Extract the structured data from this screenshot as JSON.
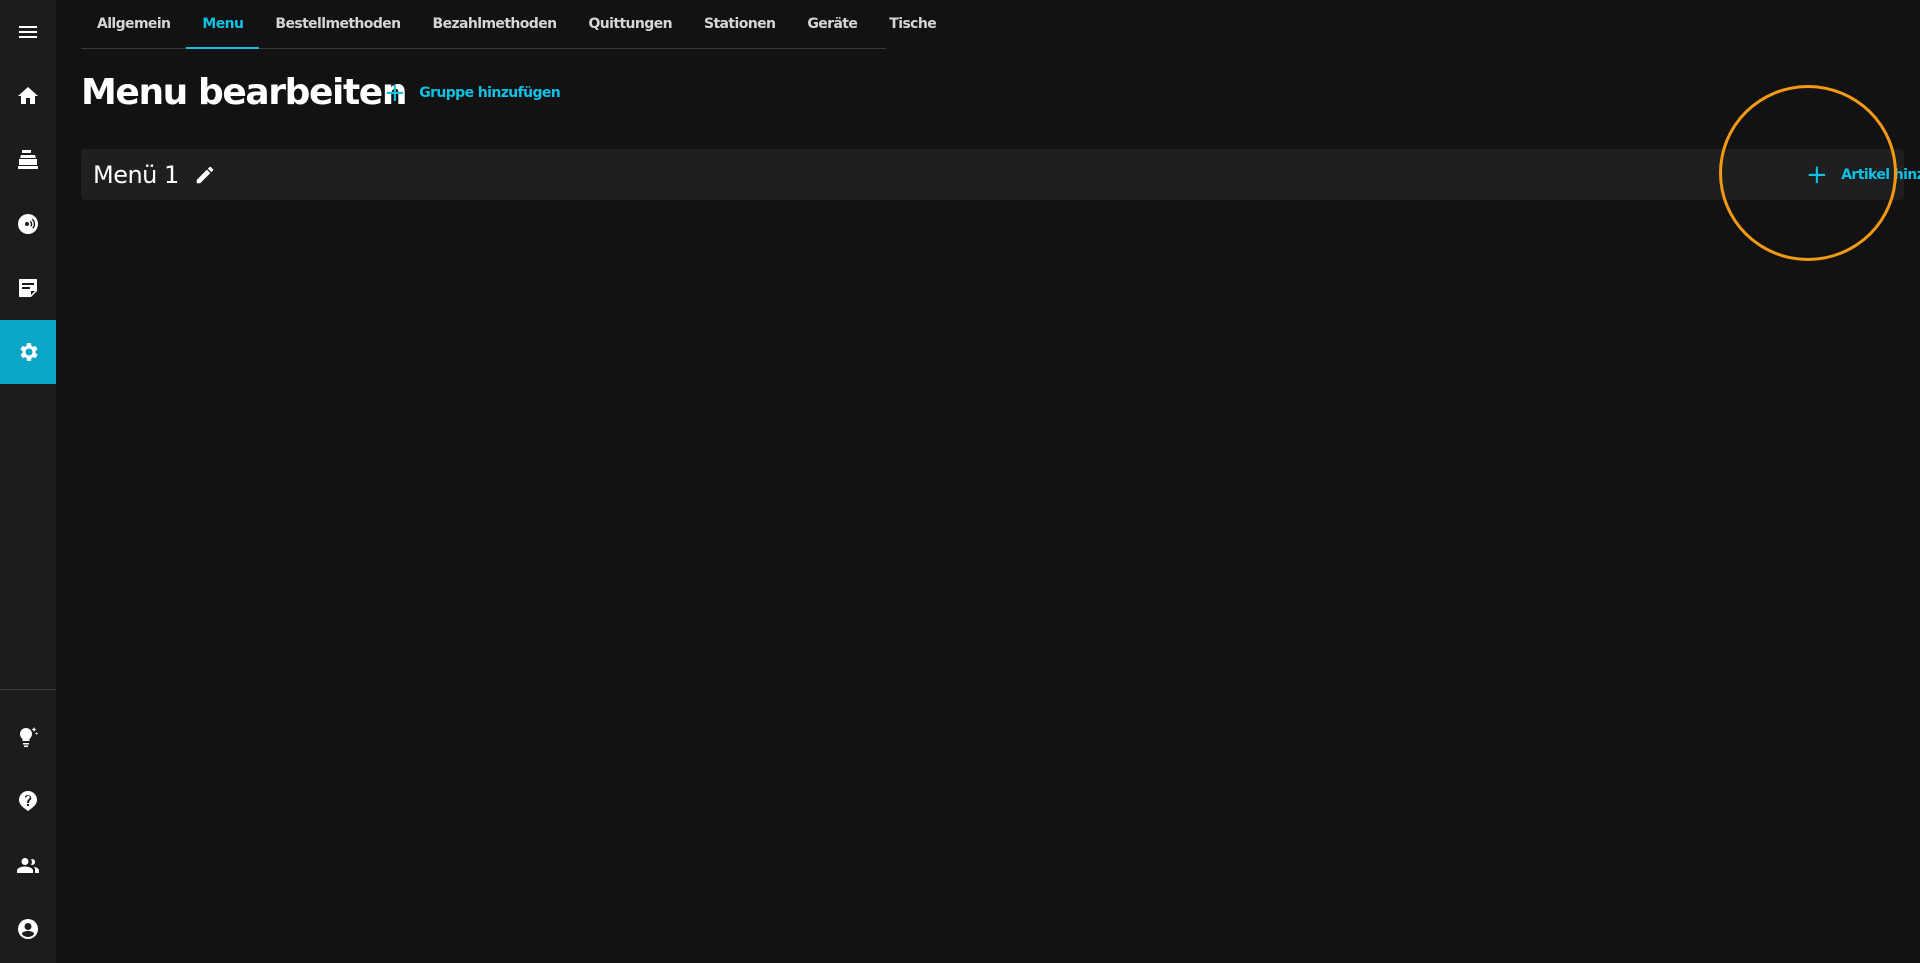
{
  "sidebar": {
    "items": [
      {
        "icon": "menu-icon"
      },
      {
        "icon": "home-icon"
      },
      {
        "icon": "cash-register-icon"
      },
      {
        "icon": "payment-icon"
      },
      {
        "icon": "notes-icon"
      },
      {
        "icon": "settings-icon",
        "active": true
      },
      {
        "icon": "lightbulb-icon"
      },
      {
        "icon": "help-icon"
      },
      {
        "icon": "users-icon"
      },
      {
        "icon": "account-icon"
      }
    ]
  },
  "tabs": [
    {
      "label": "Allgemein"
    },
    {
      "label": "Menu",
      "active": true
    },
    {
      "label": "Bestellmethoden"
    },
    {
      "label": "Bezahlmethoden"
    },
    {
      "label": "Quittungen"
    },
    {
      "label": "Stationen"
    },
    {
      "label": "Geräte"
    },
    {
      "label": "Tische"
    }
  ],
  "header": {
    "title": "Menu bearbeiten",
    "add_group_label": "Gruppe hinzufügen"
  },
  "menus": [
    {
      "name": "Menü 1",
      "add_article_label": "Artikel hinzufügen"
    }
  ],
  "colors": {
    "background": "#121212",
    "sidebar": "#1c1c1c",
    "accent": "#10c1e6",
    "active_sidebar": "#09a6c6",
    "highlight_ring": "#f29a14"
  }
}
